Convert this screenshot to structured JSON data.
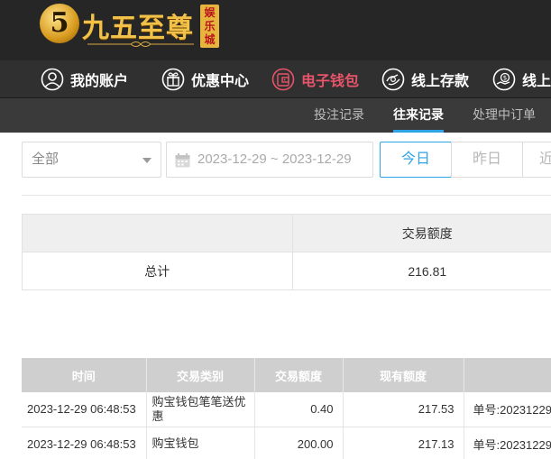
{
  "brand": {
    "logo_digit": "5",
    "name": "九五至尊",
    "seal": "娱乐城"
  },
  "main_nav": [
    {
      "label": "我的账户",
      "icon": "user-icon",
      "active": false
    },
    {
      "label": "优惠中心",
      "icon": "gift-icon",
      "active": false
    },
    {
      "label": "电子钱包",
      "icon": "wallet-icon",
      "active": true
    },
    {
      "label": "线上存款",
      "icon": "deposit-icon",
      "active": false
    },
    {
      "label": "线上",
      "icon": "withdraw-icon",
      "active": false
    }
  ],
  "sub_nav": [
    {
      "label": "投注记录",
      "active": false
    },
    {
      "label": "往来记录",
      "active": true
    },
    {
      "label": "处理中订单",
      "active": false
    }
  ],
  "filters": {
    "type_select": "全部",
    "date_range": "2023-12-29 ~ 2023-12-29",
    "quick": [
      "今日",
      "昨日",
      "近"
    ]
  },
  "summary": {
    "header": "交易额度",
    "row_label": "总计",
    "row_value": "216.81"
  },
  "records": {
    "columns": [
      "时间",
      "交易类别",
      "交易额度",
      "现有额度",
      ""
    ],
    "rows": [
      {
        "time": "2023-12-29 06:48:53",
        "type": "购宝钱包笔笔送优惠",
        "amount": "0.40",
        "balance": "217.53",
        "note": "单号:20231229"
      },
      {
        "time": "2023-12-29 06:48:53",
        "type": "购宝钱包",
        "amount": "200.00",
        "balance": "217.13",
        "note": "单号:20231229"
      }
    ]
  },
  "colors": {
    "active_nav": "#e8546a",
    "accent_blue": "#2ea3e6",
    "gold": "#f2c14a"
  }
}
